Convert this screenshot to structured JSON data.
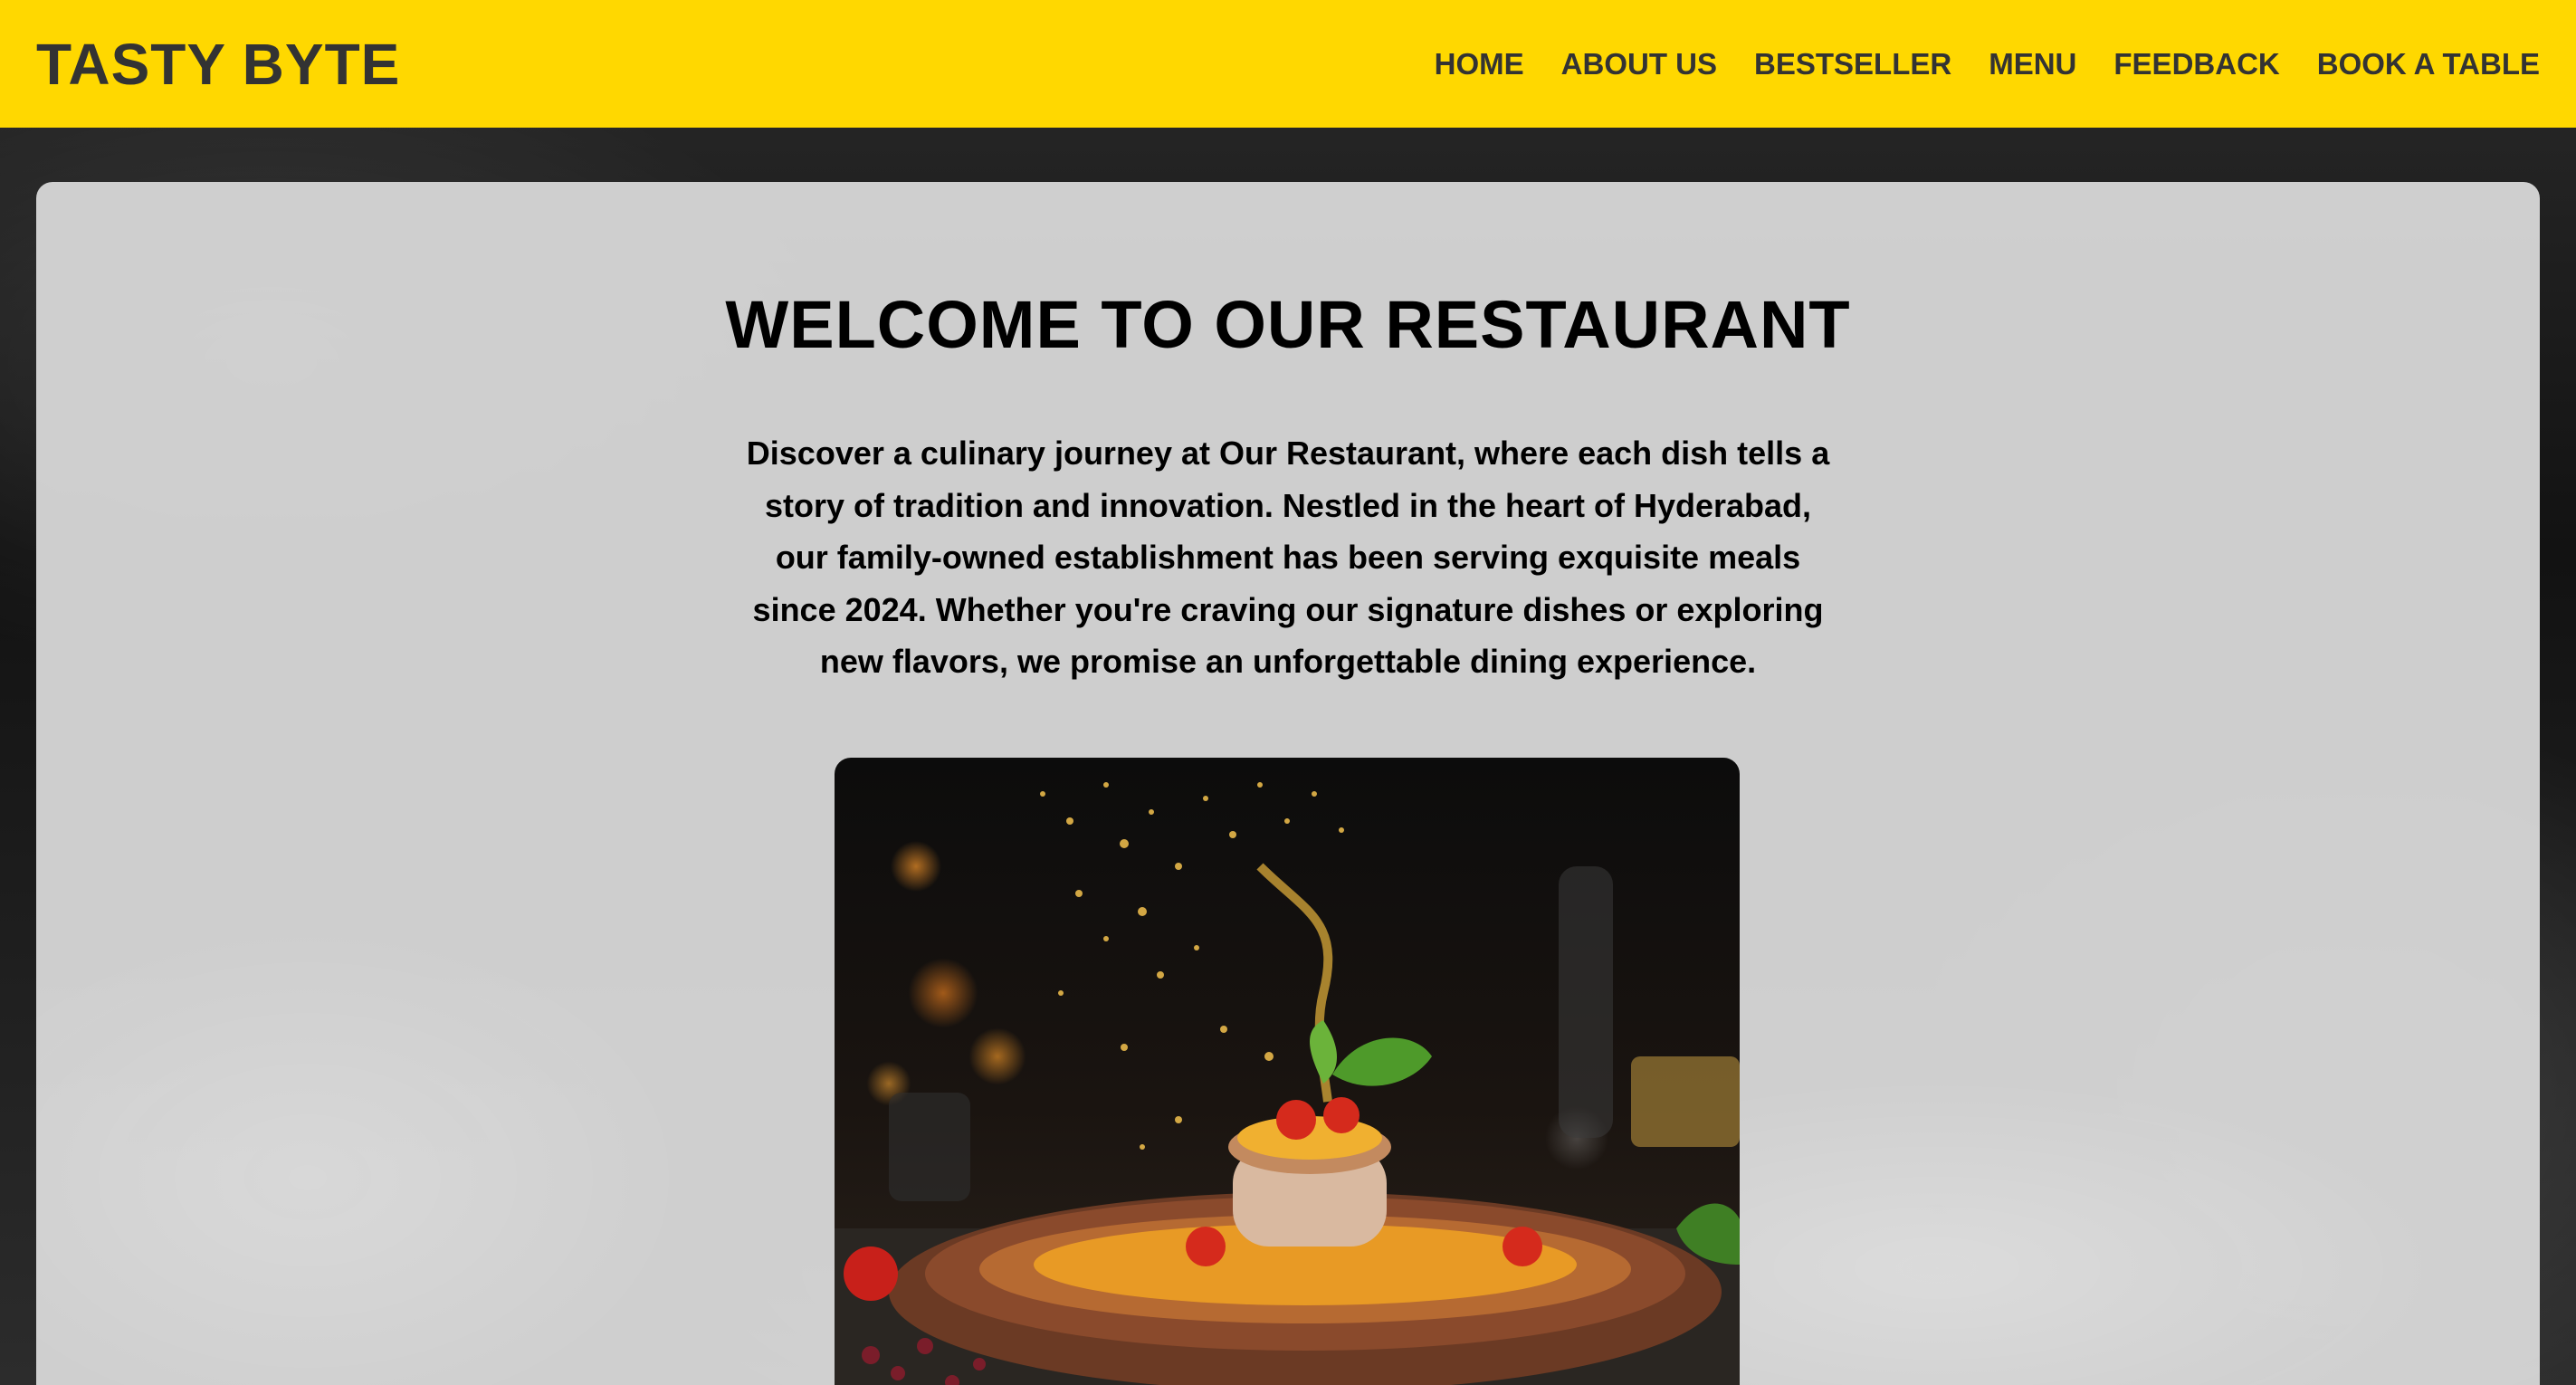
{
  "brand": {
    "name": "TASTY BYTE"
  },
  "nav": {
    "items": [
      {
        "label": "HOME"
      },
      {
        "label": "ABOUT US"
      },
      {
        "label": "BESTSELLER"
      },
      {
        "label": "MENU"
      },
      {
        "label": "FEEDBACK"
      },
      {
        "label": "BOOK A TABLE"
      }
    ]
  },
  "hero": {
    "title": "WELCOME TO OUR RESTAURANT",
    "intro": "Discover a culinary journey at Our Restaurant, where each dish tells a story of tradition and innovation. Nestled in the heart of Hyderabad, our family-owned establishment has been serving exquisite meals since 2024. Whether you're craving our signature dishes or exploring new flavors, we promise an unforgettable dining experience."
  },
  "colors": {
    "navbar": "#FFD800",
    "nav_text": "#333333",
    "heading_text": "#000000",
    "panel": "#DADADA"
  }
}
